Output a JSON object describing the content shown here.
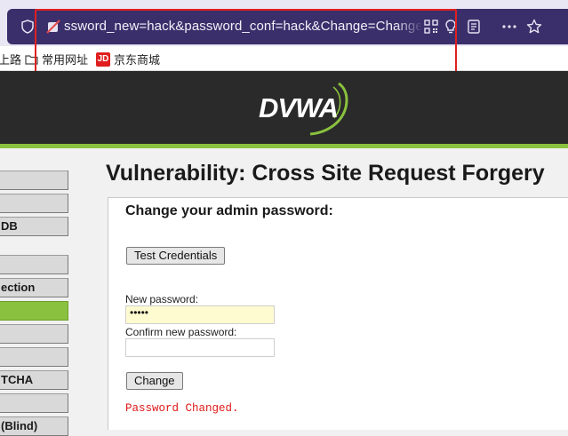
{
  "browser": {
    "url": "ssword_new=hack&password_conf=hack&Change=Change#"
  },
  "bookmarks": [
    {
      "label": "上路"
    },
    {
      "label": "常用网址"
    },
    {
      "label": "京东商城",
      "icon_text": "JD"
    }
  ],
  "dvwa": {
    "logo_text": "DVWA"
  },
  "menu": {
    "items": [
      {
        "label": ""
      },
      {
        "label": ""
      },
      {
        "label": " DB"
      },
      {
        "label": ""
      },
      {
        "label": "ection"
      },
      {
        "label": "",
        "active": true
      },
      {
        "label": ""
      },
      {
        "label": ""
      },
      {
        "label": "TCHA"
      },
      {
        "label": ""
      },
      {
        "label": " (Blind)"
      }
    ]
  },
  "main": {
    "title": "Vulnerability: Cross Site Request Forgery",
    "heading": "Change your admin password:",
    "test_button": "Test Credentials",
    "new_password_label": "New password:",
    "new_password_value": "•••••",
    "confirm_password_label": "Confirm new password:",
    "change_button": "Change",
    "result": "Password Changed."
  },
  "colors": {
    "accent_green": "#8ac13e",
    "url_bar": "#3b2f6b",
    "error_red": "#e01919"
  }
}
